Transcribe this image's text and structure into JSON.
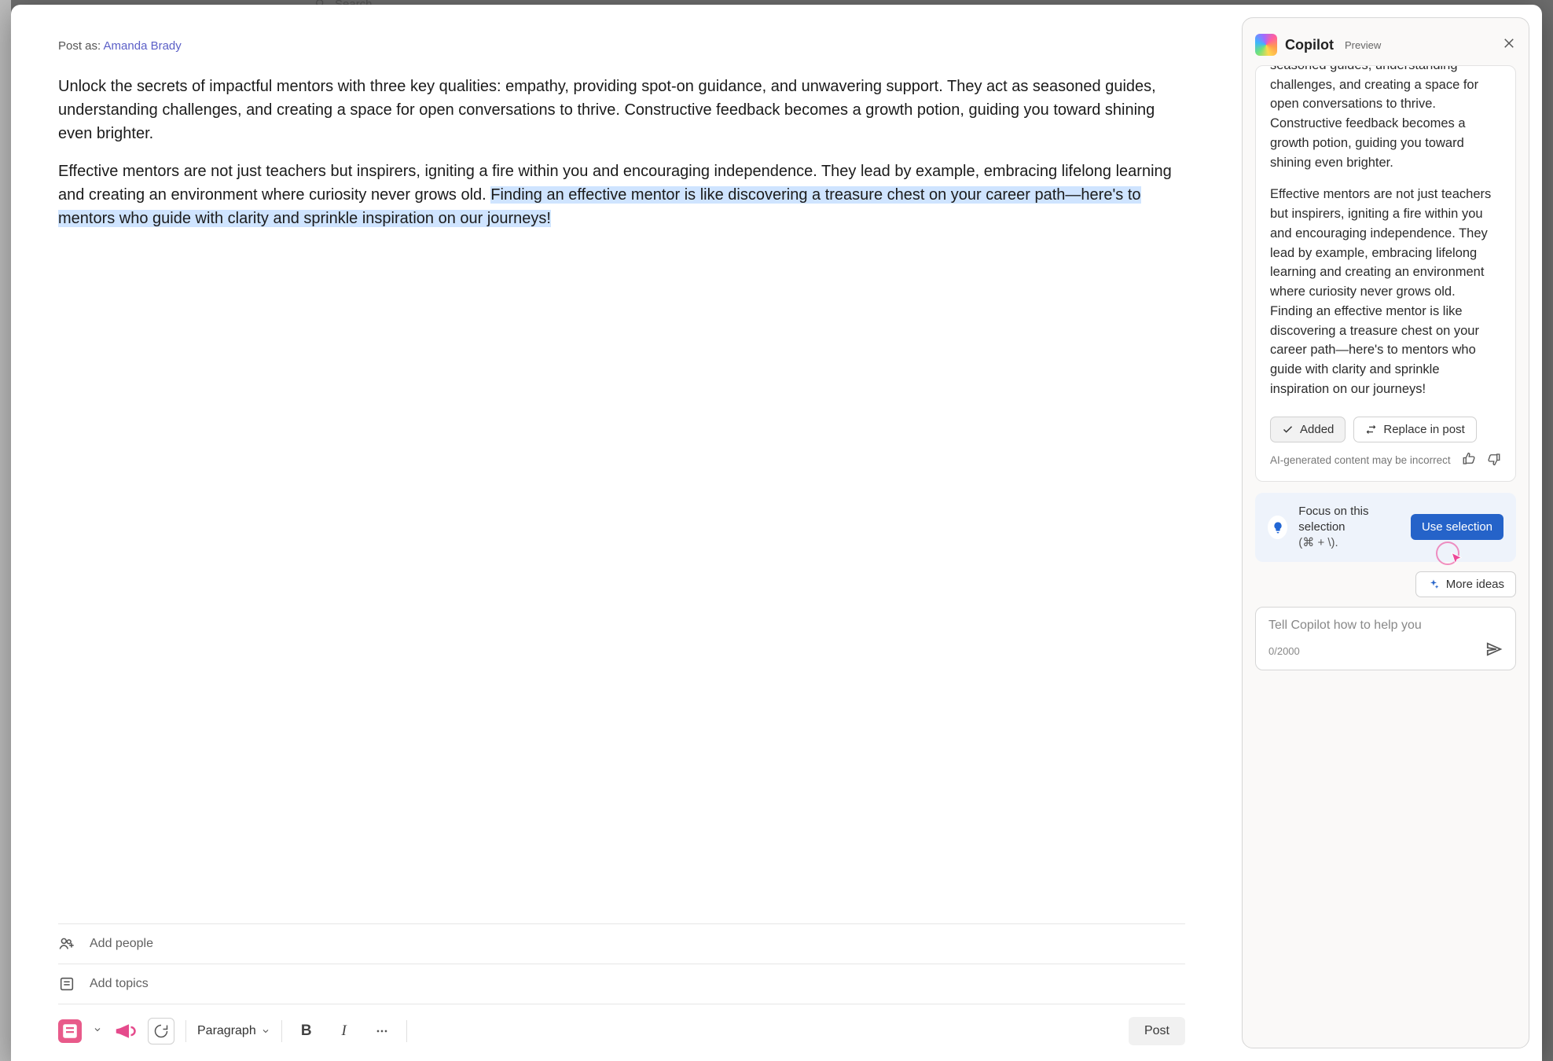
{
  "topbar": {
    "search": "Search"
  },
  "postAs": {
    "label": "Post as:",
    "author": "Amanda Brady"
  },
  "content": {
    "p1": "Unlock the secrets of impactful mentors with three key qualities: empathy, providing spot-on guidance, and unwavering support. They act as seasoned guides, understanding challenges, and creating a space for open conversations to thrive. Constructive feedback becomes a growth potion, guiding you toward shining even brighter.",
    "p2a": "Effective mentors are not just teachers but inspirers, igniting a fire within you and encouraging independence. They lead by example, embracing lifelong learning and creating an environment where curiosity never grows old. ",
    "p2sel": "Finding an effective mentor is like discovering a treasure chest on your career path—here's to mentors who guide with clarity and sprinkle inspiration on our journeys!"
  },
  "meta": {
    "addPeople": "Add people",
    "addTopics": "Add topics"
  },
  "toolbar": {
    "paragraph": "Paragraph",
    "post": "Post"
  },
  "copilot": {
    "title": "Copilot",
    "preview": "Preview",
    "msg_p1_partial": "unwavering support. They act as seasoned guides, understanding challenges, and creating a space for open conversations to thrive. Constructive feedback becomes a growth potion, guiding you toward shining even brighter.",
    "msg_p2": "Effective mentors are not just teachers but inspirers, igniting a fire within you and encouraging independence. They lead by example, embracing lifelong learning and creating an environment where curiosity never grows old. Finding an effective mentor is like discovering a treasure chest on your career path—here's to mentors who guide with clarity and sprinkle inspiration on our journeys!",
    "added": "Added",
    "replace": "Replace in post",
    "disclaimer": "AI-generated content may be incorrect",
    "selection_line1": "Focus on this selection",
    "selection_line2": "(⌘ + \\).",
    "use_selection": "Use selection",
    "more_ideas": "More ideas",
    "input_placeholder": "Tell Copilot how to help you",
    "char_count": "0/2000"
  }
}
